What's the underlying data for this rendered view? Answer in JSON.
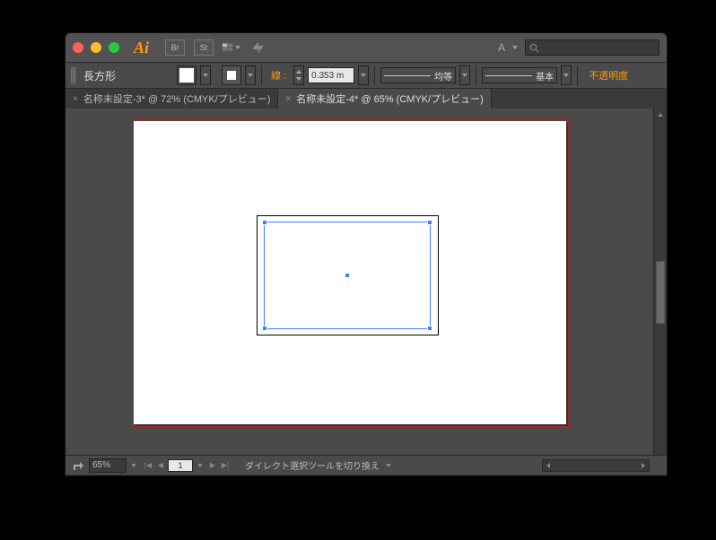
{
  "app": {
    "logo": "Ai",
    "bridge_icon": "Br",
    "stock_icon": "St"
  },
  "title": {
    "char_sample": "A"
  },
  "control": {
    "tool_name": "長方形",
    "stroke_label": "線 :",
    "stroke_value": "0.353 m",
    "profile_label": "均等",
    "brush_label": "基本",
    "opacity_label": "不透明度"
  },
  "tabs": {
    "items": [
      {
        "close": "×",
        "label": "名称未設定-3* @ 72% (CMYK/プレビュー)"
      },
      {
        "close": "×",
        "label": "名称未設定-4* @ 65% (CMYK/プレビュー)"
      }
    ]
  },
  "status": {
    "zoom": "65%",
    "page": "1",
    "hint": "ダイレクト選択ツールを切り換え"
  }
}
